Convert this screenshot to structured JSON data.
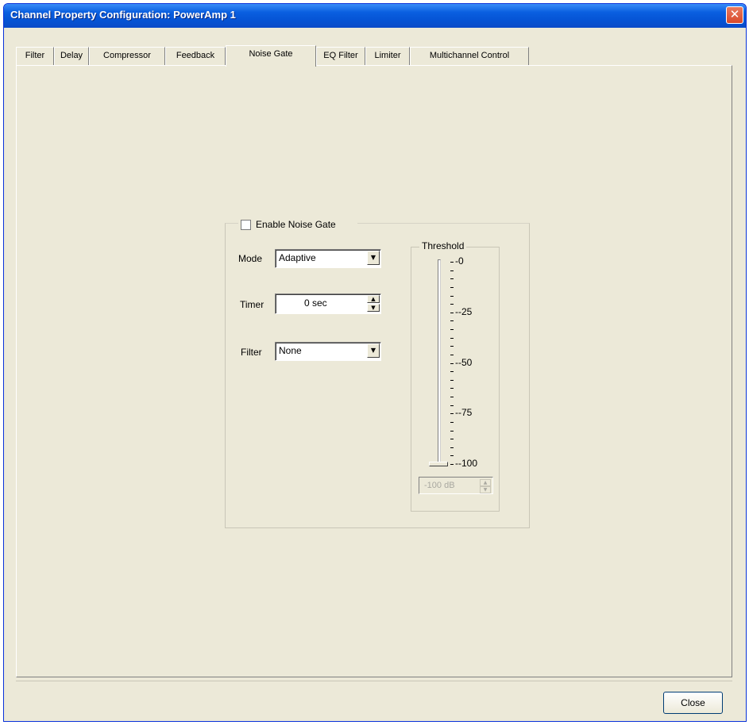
{
  "window": {
    "title": "Channel Property Configuration: PowerAmp 1",
    "close_glyph": "✕"
  },
  "tabs": [
    {
      "label": "Filter",
      "active": false
    },
    {
      "label": "Delay",
      "active": false
    },
    {
      "label": "Compressor",
      "active": false
    },
    {
      "label": "Feedback",
      "active": false
    },
    {
      "label": "Noise Gate",
      "active": true
    },
    {
      "label": "EQ Filter",
      "active": false
    },
    {
      "label": "Limiter",
      "active": false
    },
    {
      "label": "Multichannel Control",
      "active": false
    }
  ],
  "noise_gate": {
    "enable_label": "Enable Noise Gate",
    "enabled": false,
    "mode_label": "Mode",
    "mode_value": "Adaptive",
    "timer_label": "Timer",
    "timer_value": "0 sec",
    "filter_label": "Filter",
    "filter_value": "None"
  },
  "threshold": {
    "title": "Threshold",
    "ticks": [
      "-0",
      "--25",
      "--50",
      "--75",
      "--100"
    ],
    "slider_value_db": -100,
    "value_text": "-100 dB",
    "enabled": false
  },
  "icons": {
    "dropdown": "dropdown-arrow-icon",
    "spin_up": "spin-up-icon",
    "spin_down": "spin-down-icon"
  },
  "footer": {
    "close_label": "Close"
  }
}
